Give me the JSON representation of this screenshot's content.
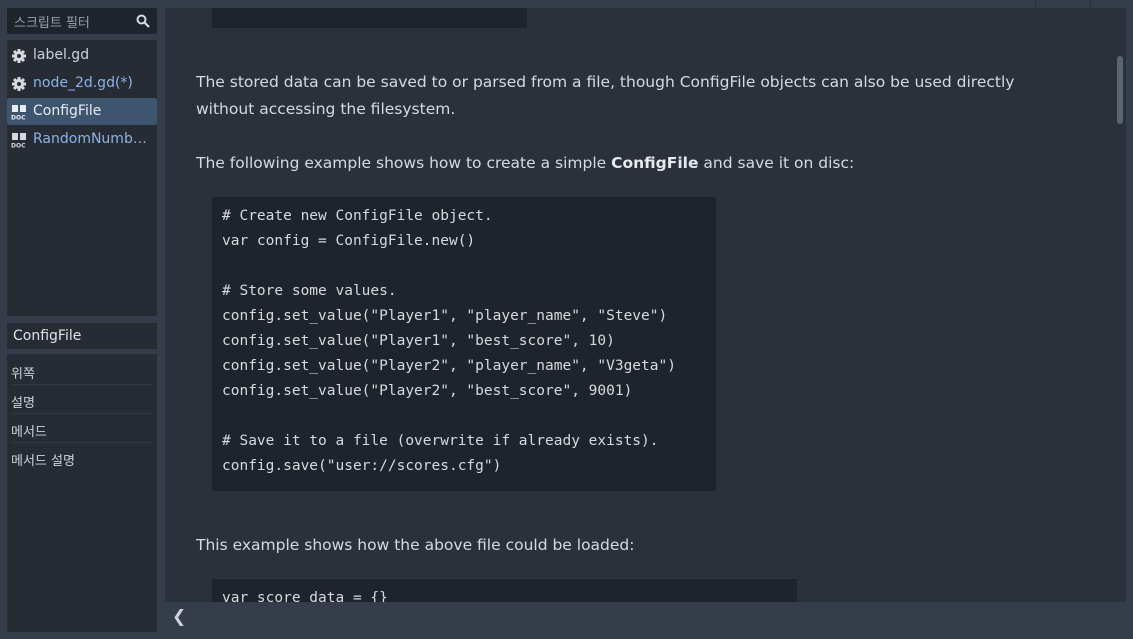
{
  "filter": {
    "placeholder": "스크립트 필터",
    "icon": "search-icon"
  },
  "scripts": [
    {
      "label": "label.gd",
      "icon": "gear-icon",
      "style": "plain"
    },
    {
      "label": "node_2d.gd(*)",
      "icon": "gear-icon",
      "style": "link"
    },
    {
      "label": "ConfigFile",
      "icon": "doc-icon",
      "style": "white",
      "selected": true
    },
    {
      "label": "RandomNumberGenerator",
      "icon": "doc-icon",
      "style": "link"
    }
  ],
  "doc_title": "ConfigFile",
  "outline": [
    "위쪽",
    "설명",
    "메서드",
    "메서드 설명"
  ],
  "content": {
    "para1": "The stored data can be saved to or parsed from a file, though ConfigFile objects can also be used directly without accessing the filesystem.",
    "para2_pre": "The following example shows how to create a simple ",
    "para2_bold": "ConfigFile",
    "para2_post": " and save it on disc:",
    "code1": "# Create new ConfigFile object.\nvar config = ConfigFile.new()\n\n# Store some values.\nconfig.set_value(\"Player1\", \"player_name\", \"Steve\")\nconfig.set_value(\"Player1\", \"best_score\", 10)\nconfig.set_value(\"Player2\", \"player_name\", \"V3geta\")\nconfig.set_value(\"Player2\", \"best_score\", 9001)\n\n# Save it to a file (overwrite if already exists).\nconfig.save(\"user://scores.cfg\")",
    "para3": "This example shows how the above file could be loaded:",
    "code2": "var score_data = {}"
  },
  "bottom": {
    "collapse_glyph": "❮"
  },
  "colors": {
    "selection": "#3e5570",
    "link": "#8ab4e6",
    "code_bg": "#1f242c"
  }
}
